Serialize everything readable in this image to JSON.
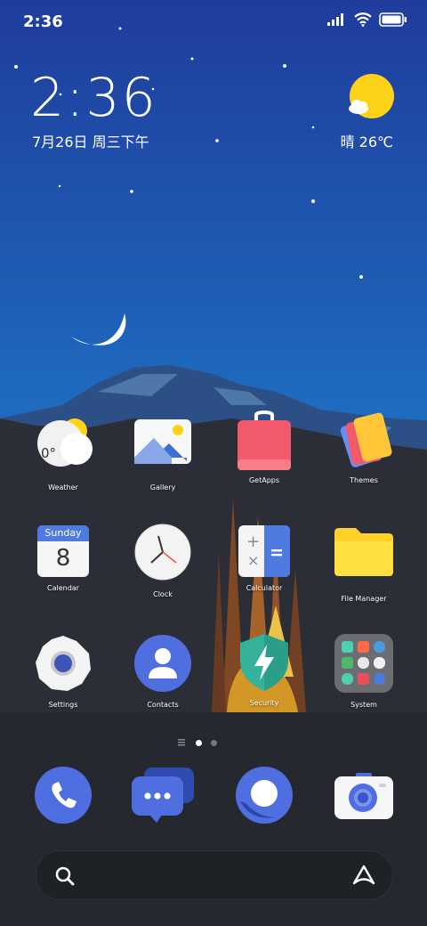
{
  "status_bar": {
    "time": "2:36",
    "signal_icon": "signal-icon",
    "wifi_icon": "wifi-icon",
    "battery_icon": "battery-icon"
  },
  "clock_widget": {
    "time": "2:36",
    "date": "7月26日 周三下午",
    "weather": "晴 26℃",
    "weather_icon": "sun-icon"
  },
  "apps": [
    {
      "label": "Weather",
      "icon": "weather-icon"
    },
    {
      "label": "Gallery",
      "icon": "gallery-icon"
    },
    {
      "label": "GetApps",
      "icon": "getapps-icon"
    },
    {
      "label": "Themes",
      "icon": "themes-icon"
    },
    {
      "label": "Calendar",
      "icon": "calendar-icon",
      "calendar_day": "Sunday",
      "calendar_date": "8"
    },
    {
      "label": "Clock",
      "icon": "clock-icon"
    },
    {
      "label": "Calculator",
      "icon": "calculator-icon"
    },
    {
      "label": "File Manager",
      "icon": "folder-icon"
    },
    {
      "label": "Settings",
      "icon": "settings-icon"
    },
    {
      "label": "Contacts",
      "icon": "contacts-icon"
    },
    {
      "label": "Security",
      "icon": "security-icon"
    },
    {
      "label": "System",
      "icon": "system-folder-icon"
    }
  ],
  "weather_widget_icon_temp": "0°",
  "page_indicator": {
    "pages": 2,
    "current": 1
  },
  "dock": [
    {
      "name": "phone",
      "icon": "phone-icon"
    },
    {
      "name": "messaging",
      "icon": "message-icon"
    },
    {
      "name": "browser",
      "icon": "browser-icon"
    },
    {
      "name": "camera",
      "icon": "camera-icon"
    }
  ],
  "search_bar": {
    "search_icon": "search-icon",
    "assistant_icon": "assistant-icon"
  },
  "colors": {
    "sky_top": "#1d3e9a",
    "sky_bottom": "#1a7fc9",
    "ground": "#2a2d36"
  }
}
